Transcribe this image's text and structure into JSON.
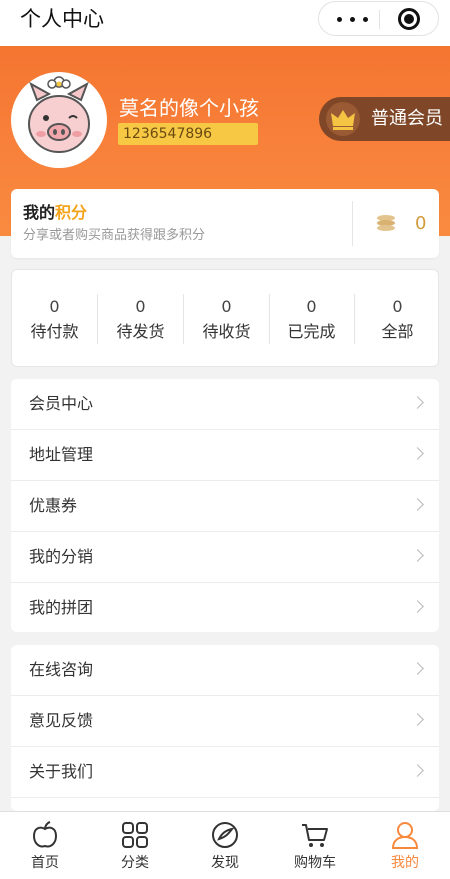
{
  "navbar": {
    "title": "个人中心"
  },
  "user": {
    "name": "莫名的像个小孩",
    "id": "1236547896"
  },
  "membership": {
    "label": "普通会员"
  },
  "points": {
    "title_prefix": "我的",
    "title_highlight": "积分",
    "subtitle": "分享或者购买商品获得跟多积分",
    "value": "0"
  },
  "orders": [
    {
      "count": "0",
      "label": "待付款"
    },
    {
      "count": "0",
      "label": "待发货"
    },
    {
      "count": "0",
      "label": "待收货"
    },
    {
      "count": "0",
      "label": "已完成"
    },
    {
      "count": "0",
      "label": "全部"
    }
  ],
  "menu1": [
    {
      "label": "会员中心"
    },
    {
      "label": "地址管理"
    },
    {
      "label": "优惠券"
    },
    {
      "label": "我的分销"
    },
    {
      "label": "我的拼团"
    }
  ],
  "menu2": [
    {
      "label": "在线咨询"
    },
    {
      "label": "意见反馈"
    },
    {
      "label": "关于我们"
    }
  ],
  "tabs": [
    {
      "label": "首页",
      "icon": "apple-icon"
    },
    {
      "label": "分类",
      "icon": "grid-icon"
    },
    {
      "label": "发现",
      "icon": "compass-icon"
    },
    {
      "label": "购物车",
      "icon": "cart-icon"
    },
    {
      "label": "我的",
      "icon": "user-icon"
    }
  ],
  "colors": {
    "accent": "#f7893d",
    "points_highlight": "#f3a41c",
    "badge_bg": "#7f4627",
    "id_bg": "#f7c844"
  }
}
